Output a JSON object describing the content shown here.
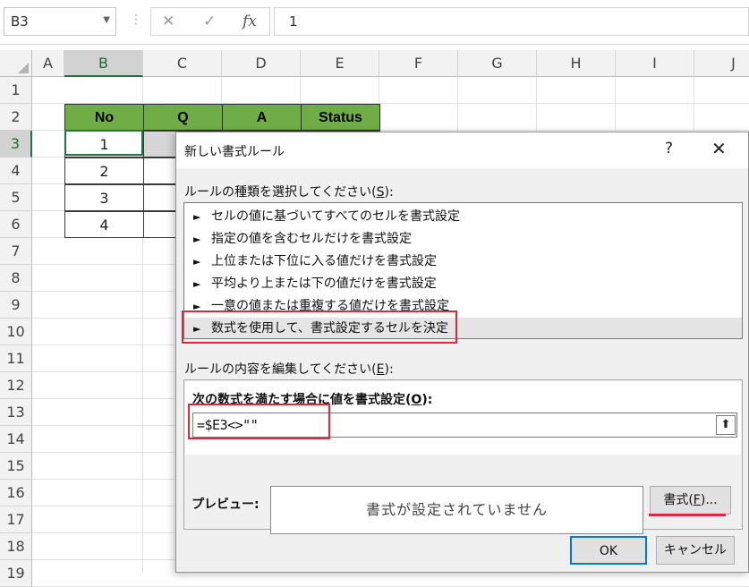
{
  "formula_bar": {
    "name_box": "B3",
    "separator": "⋮",
    "cancel_icon": "✕",
    "enter_icon": "✓",
    "fx_icon": "fx",
    "value": "1"
  },
  "sheet": {
    "columns": [
      "A",
      "B",
      "C",
      "D",
      "E",
      "F",
      "G",
      "H",
      "I",
      "J"
    ],
    "rows": [
      "1",
      "2",
      "3",
      "4",
      "5",
      "6",
      "7",
      "8",
      "9",
      "10",
      "11",
      "12",
      "13",
      "14",
      "15",
      "16",
      "17",
      "18",
      "19"
    ],
    "selected_column": "B",
    "selected_row": "3",
    "table": {
      "headers": [
        "No",
        "Q",
        "A",
        "Status"
      ],
      "rows": [
        "1",
        "2",
        "3",
        "4"
      ],
      "header_color": "#70ad47"
    }
  },
  "dialog": {
    "title": "新しい書式ルール",
    "help": "?",
    "close": "✕",
    "rule_type_label": "ルールの種類を選択してください(",
    "rule_type_key": "S",
    "rule_type_tail": "):",
    "rule_types": [
      "セルの値に基づいてすべてのセルを書式設定",
      "指定の値を含むセルだけを書式設定",
      "上位または下位に入る値だけを書式設定",
      "平均より上または下の値だけを書式設定",
      "一意の値または重複する値だけを書式設定",
      "数式を使用して、書式設定するセルを決定"
    ],
    "rule_arrow": "►",
    "selected_rule_index": 5,
    "edit_label": "ルールの内容を編集してください(",
    "edit_key": "E",
    "edit_tail": "):",
    "formula_label": "次の数式を満たす場合に値を書式設定(",
    "formula_key": "O",
    "formula_tail": "):",
    "formula_value": "=$E3<>\"\"",
    "collapse_icon": "⬆",
    "preview_label": "プレビュー:",
    "preview_text": "書式が設定されていません",
    "format_button_pre": "書式(",
    "format_button_key": "F",
    "format_button_post": ")...",
    "ok": "OK",
    "cancel": "キャンセル",
    "highlight_color": "#e0283a"
  }
}
